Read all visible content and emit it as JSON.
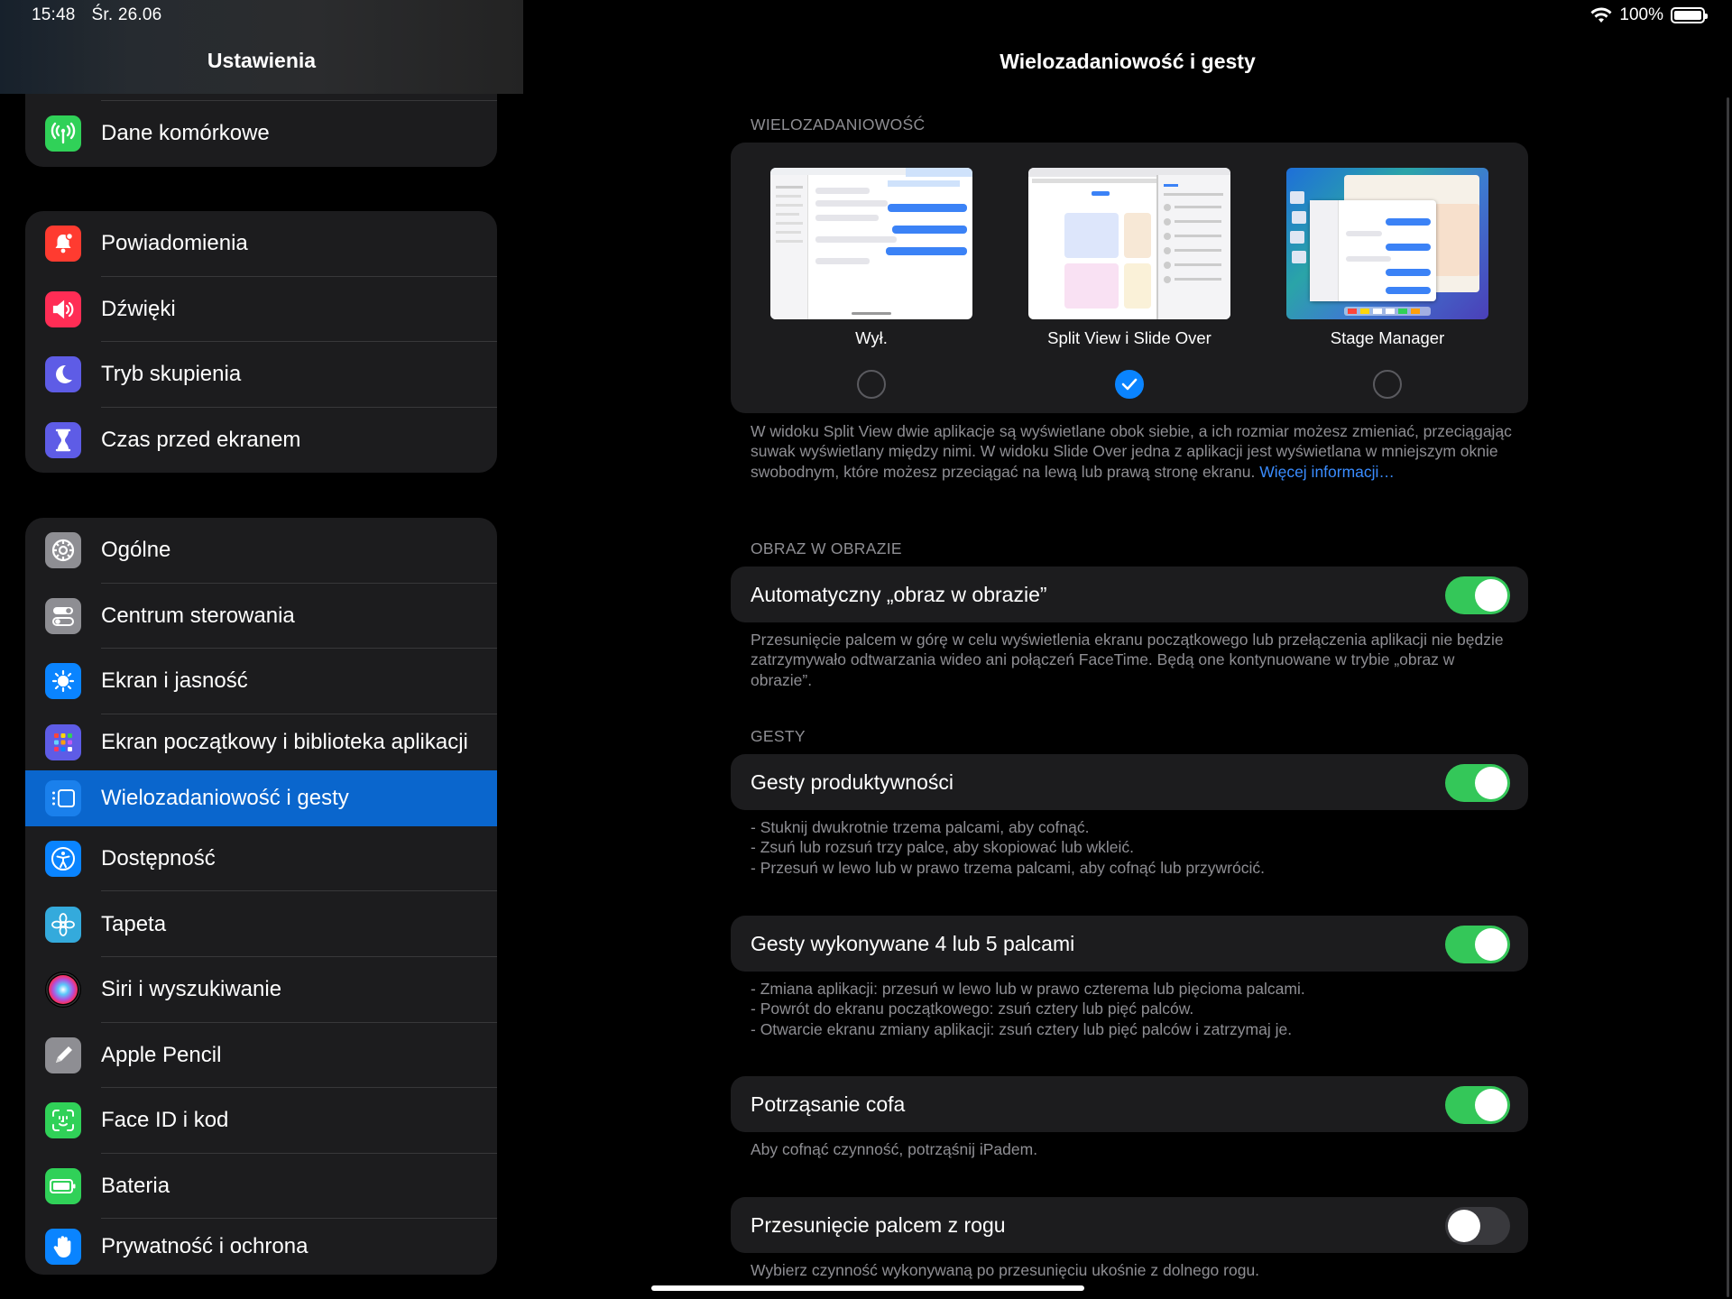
{
  "status": {
    "time": "15:48",
    "date": "Śr. 26.06",
    "battery": "100%"
  },
  "sidebar": {
    "title": "Ustawienia",
    "group1": [
      {
        "label": "Dane komórkowe",
        "icon": "antenna-icon",
        "color": "#30d158"
      }
    ],
    "group2": [
      {
        "label": "Powiadomienia",
        "icon": "bell-icon",
        "color": "#ff3b30"
      },
      {
        "label": "Dźwięki",
        "icon": "speaker-icon",
        "color": "#ff2d55"
      },
      {
        "label": "Tryb skupienia",
        "icon": "moon-icon",
        "color": "#5e5ce6"
      },
      {
        "label": "Czas przed ekranem",
        "icon": "hourglass-icon",
        "color": "#5e5ce6"
      }
    ],
    "group3": [
      {
        "label": "Ogólne",
        "icon": "gear-icon",
        "color": "#8e8e93"
      },
      {
        "label": "Centrum sterowania",
        "icon": "toggles-icon",
        "color": "#8e8e93"
      },
      {
        "label": "Ekran i jasność",
        "icon": "sun-icon",
        "color": "#0a84ff"
      },
      {
        "label": "Ekran początkowy i biblioteka aplikacji",
        "icon": "app-grid-icon",
        "color": "#5e5ce6"
      },
      {
        "label": "Wielozadaniowość i gesty",
        "icon": "multitasking-icon",
        "color": "#1a80ec",
        "selected": true
      },
      {
        "label": "Dostępność",
        "icon": "accessibility-icon",
        "color": "#0a84ff"
      },
      {
        "label": "Tapeta",
        "icon": "flower-icon",
        "color": "#34aadc"
      },
      {
        "label": "Siri i wyszukiwanie",
        "icon": "siri-icon",
        "color": "#000000"
      },
      {
        "label": "Apple Pencil",
        "icon": "pencil-icon",
        "color": "#8e8e93"
      },
      {
        "label": "Face ID i kod",
        "icon": "face-id-icon",
        "color": "#30d158"
      },
      {
        "label": "Bateria",
        "icon": "battery-icon",
        "color": "#30d158"
      },
      {
        "label": "Prywatność i ochrona",
        "icon": "hand-icon",
        "color": "#0a84ff"
      }
    ]
  },
  "content": {
    "title": "Wielozadaniowość i gesty",
    "multitasking": {
      "header": "WIELOZADANIOWOŚĆ",
      "options": [
        {
          "label": "Wył.",
          "checked": false
        },
        {
          "label": "Split View i Slide Over",
          "checked": true
        },
        {
          "label": "Stage Manager",
          "checked": false
        }
      ],
      "footer": "W widoku Split View dwie aplikacje są wyświetlane obok siebie, a ich rozmiar możesz zmieniać, przeciągając suwak wyświetlany między nimi. W widoku Slide Over jedna z aplikacji jest wyświetlana w mniejszym oknie swobodnym, które możesz przeciągać na lewą lub prawą stronę ekranu.",
      "link": "Więcej informacji…"
    },
    "pip": {
      "header": "OBRAZ W OBRAZIE",
      "label": "Automatyczny „obraz w obrazie”",
      "footer": "Przesunięcie palcem w górę w celu wyświetlenia ekranu początkowego lub przełączenia aplikacji nie będzie zatrzymywało odtwarzania wideo ani połączeń FaceTime. Będą one kontynuowane w trybie „obraz w obrazie”."
    },
    "gestures": {
      "header": "GESTY",
      "productivity": {
        "label": "Gesty produktywności",
        "footer": "- Stuknij dwukrotnie trzema palcami, aby cofnąć.\n- Zsuń lub rozsuń trzy palce, aby skopiować lub wkleić.\n- Przesuń w lewo lub w prawo trzema palcami, aby cofnąć lub przywrócić."
      },
      "four_five": {
        "label": "Gesty wykonywane 4 lub 5 palcami",
        "footer": "- Zmiana aplikacji: przesuń w lewo lub w prawo czterema lub pięcioma palcami.\n- Powrót do ekranu początkowego: zsuń cztery lub pięć palców.\n- Otwarcie ekranu zmiany aplikacji: zsuń cztery lub pięć palców i zatrzymaj je."
      },
      "shake": {
        "label": "Potrząsanie cofa",
        "footer": "Aby cofnąć czynność, potrząśnij iPadem."
      },
      "corner": {
        "label": "Przesunięcie palcem z rogu",
        "footer": "Wybierz czynność wykonywaną po przesunięciu ukośnie z dolnego rogu."
      }
    }
  }
}
